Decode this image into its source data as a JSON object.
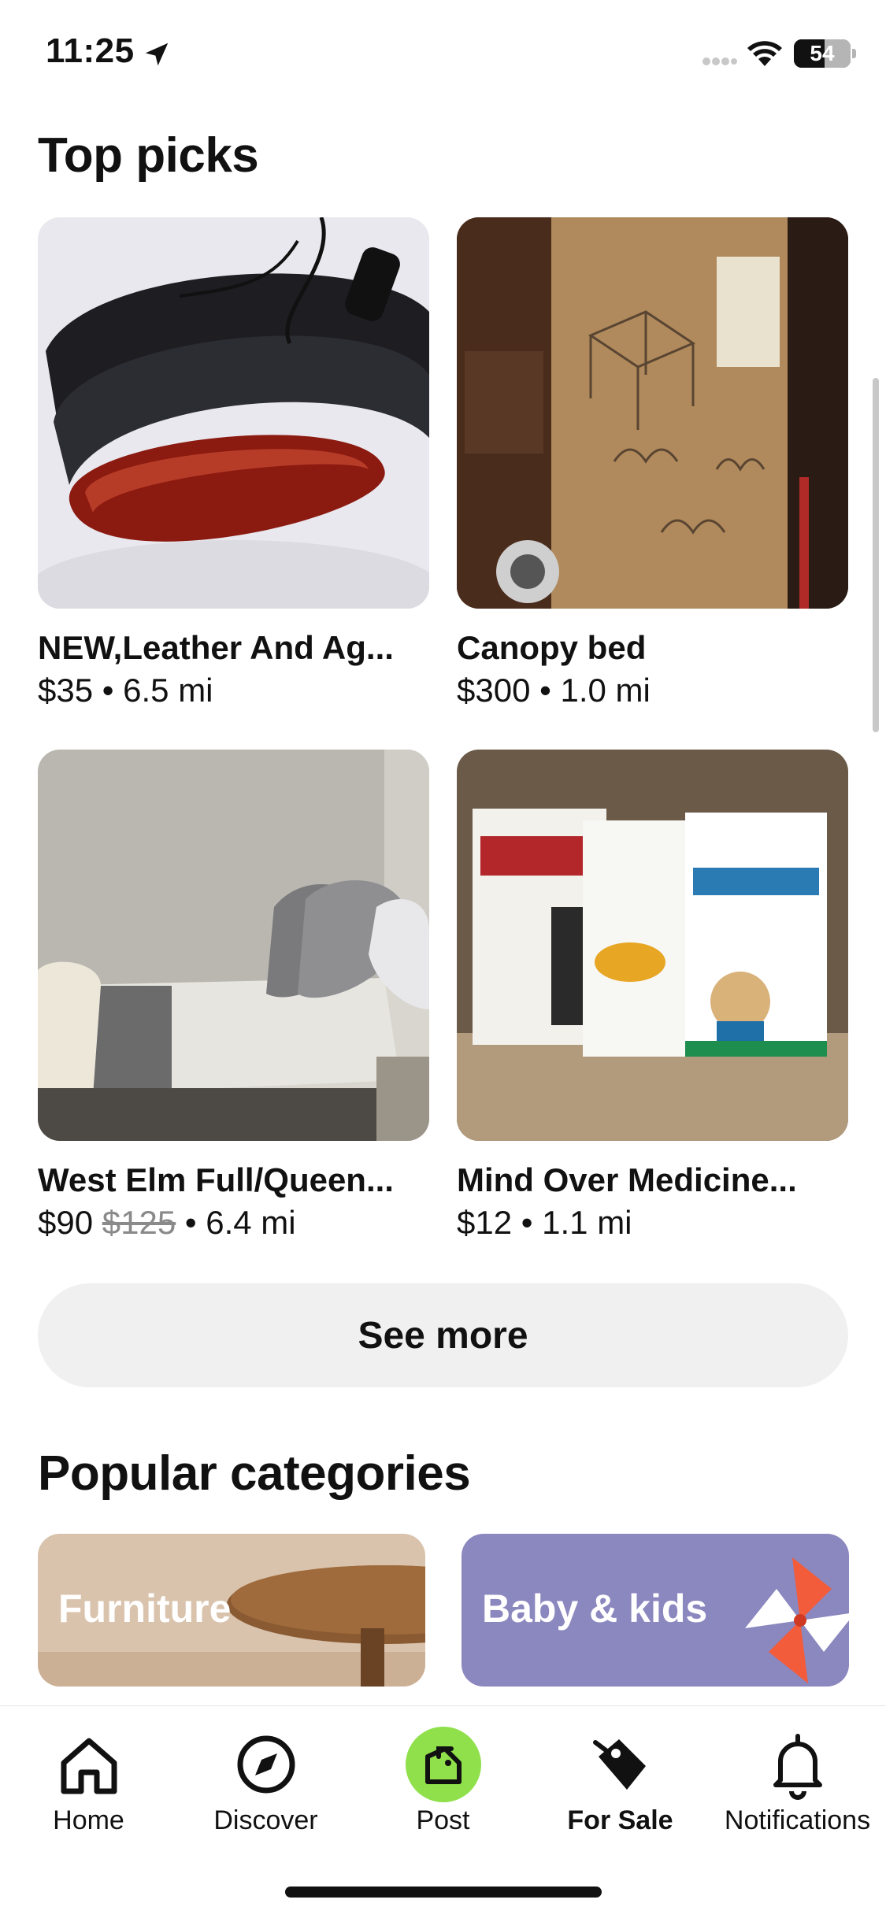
{
  "status_bar": {
    "time": "11:25",
    "battery": "54",
    "battery_level": 0.54,
    "icons": [
      "location-arrow-icon",
      "cellular-signal-icon",
      "wifi-icon",
      "battery-icon"
    ]
  },
  "top_picks": {
    "title": "Top picks",
    "items": [
      {
        "title": "NEW,Leather And Ag...",
        "price": "$35",
        "distance": "6.5 mi"
      },
      {
        "title": "Canopy bed",
        "price": "$300",
        "distance": "1.0 mi"
      },
      {
        "title": "West Elm Full/Queen...",
        "price": "$90",
        "original_price": "$125",
        "distance": "6.4 mi"
      },
      {
        "title": "Mind Over Medicine...",
        "price": "$12",
        "distance": "1.1 mi"
      }
    ],
    "separator": "•",
    "see_more": "See more"
  },
  "popular_categories": {
    "title": "Popular categories",
    "items": [
      {
        "label": "Furniture"
      },
      {
        "label": "Baby & kids"
      }
    ]
  },
  "tabbar": {
    "items": [
      {
        "label": "Home",
        "icon": "home-icon"
      },
      {
        "label": "Discover",
        "icon": "compass-icon"
      },
      {
        "label": "Post",
        "icon": "post-tag-icon"
      },
      {
        "label": "For Sale",
        "icon": "price-tag-icon",
        "active": true
      },
      {
        "label": "Notifications",
        "icon": "bell-icon"
      }
    ],
    "accent_color": "#8fe04a"
  }
}
